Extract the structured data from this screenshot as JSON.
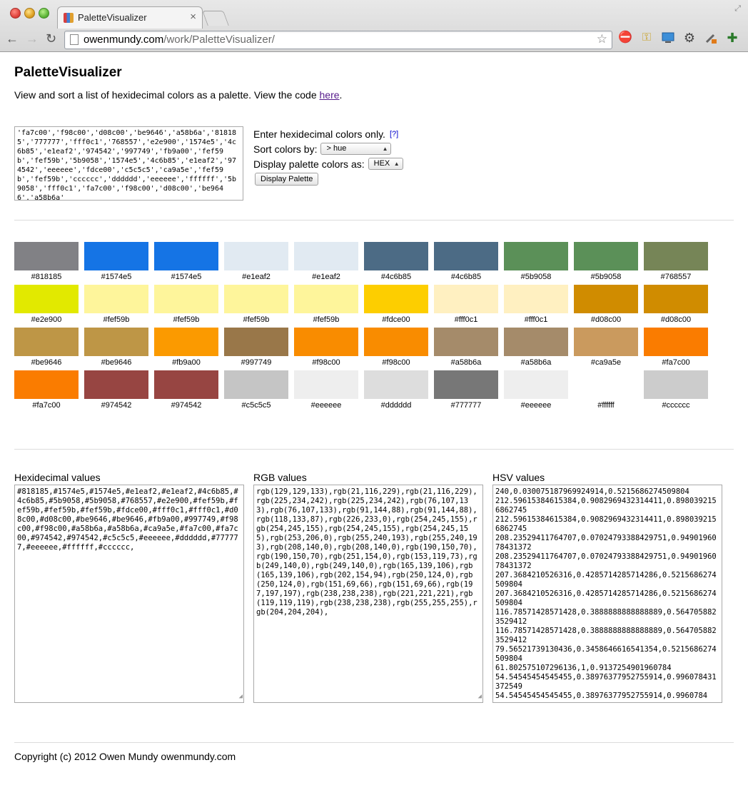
{
  "browser": {
    "tab_title": "PaletteVisualizer",
    "tab_close": "×",
    "url_host": "owenmundy.com",
    "url_path": "/work/PaletteVisualizer/"
  },
  "page": {
    "title": "PaletteVisualizer",
    "intro_text": "View and sort a list of hexidecimal colors as a palette. View the code ",
    "intro_link": "here",
    "intro_end": ".",
    "input_value": "'fa7c00','f98c00','d08c00','be9646','a58b6a','818185','777777','fff0c1','768557','e2e900','1574e5','4c6b85','e1eaf2','974542','997749','fb9a00','fef59b','fef59b','5b9058','1574e5','4c6b85','e1eaf2','974542','eeeeee','fdce00','c5c5c5','ca9a5e','fef59b','fef59b','cccccc','dddddd','eeeeee','ffffff','5b9058','fff0c1','fa7c00','f98c00','d08c00','be9646','a58b6a'",
    "controls": {
      "hex_only_label": "Enter hexidecimal colors only.",
      "help_link": "[?]",
      "sort_label": "Sort colors by:",
      "sort_value": "> hue",
      "display_label": "Display palette colors as:",
      "display_value": "HEX",
      "button_label": "Display Palette"
    },
    "palette": [
      {
        "hex": "#818185"
      },
      {
        "hex": "#1574e5"
      },
      {
        "hex": "#1574e5"
      },
      {
        "hex": "#e1eaf2"
      },
      {
        "hex": "#e1eaf2"
      },
      {
        "hex": "#4c6b85"
      },
      {
        "hex": "#4c6b85"
      },
      {
        "hex": "#5b9058"
      },
      {
        "hex": "#5b9058"
      },
      {
        "hex": "#768557"
      },
      {
        "hex": "#e2e900"
      },
      {
        "hex": "#fef59b"
      },
      {
        "hex": "#fef59b"
      },
      {
        "hex": "#fef59b"
      },
      {
        "hex": "#fef59b"
      },
      {
        "hex": "#fdce00"
      },
      {
        "hex": "#fff0c1"
      },
      {
        "hex": "#fff0c1"
      },
      {
        "hex": "#d08c00"
      },
      {
        "hex": "#d08c00"
      },
      {
        "hex": "#be9646"
      },
      {
        "hex": "#be9646"
      },
      {
        "hex": "#fb9a00"
      },
      {
        "hex": "#997749"
      },
      {
        "hex": "#f98c00"
      },
      {
        "hex": "#f98c00"
      },
      {
        "hex": "#a58b6a"
      },
      {
        "hex": "#a58b6a"
      },
      {
        "hex": "#ca9a5e"
      },
      {
        "hex": "#fa7c00"
      },
      {
        "hex": "#fa7c00"
      },
      {
        "hex": "#974542"
      },
      {
        "hex": "#974542"
      },
      {
        "hex": "#c5c5c5"
      },
      {
        "hex": "#eeeeee"
      },
      {
        "hex": "#dddddd"
      },
      {
        "hex": "#777777"
      },
      {
        "hex": "#eeeeee"
      },
      {
        "hex": "#ffffff"
      },
      {
        "hex": "#cccccc"
      }
    ],
    "hex_title": "Hexidecimal values",
    "hex_values": "#818185,#1574e5,#1574e5,#e1eaf2,#e1eaf2,#4c6b85,#4c6b85,#5b9058,#5b9058,#768557,#e2e900,#fef59b,#fef59b,#fef59b,#fef59b,#fdce00,#fff0c1,#fff0c1,#d08c00,#d08c00,#be9646,#be9646,#fb9a00,#997749,#f98c00,#f98c00,#a58b6a,#a58b6a,#ca9a5e,#fa7c00,#fa7c00,#974542,#974542,#c5c5c5,#eeeeee,#dddddd,#777777,#eeeeee,#ffffff,#cccccc,",
    "rgb_title": "RGB values",
    "rgb_values": "rgb(129,129,133),rgb(21,116,229),rgb(21,116,229),rgb(225,234,242),rgb(225,234,242),rgb(76,107,133),rgb(76,107,133),rgb(91,144,88),rgb(91,144,88),rgb(118,133,87),rgb(226,233,0),rgb(254,245,155),rgb(254,245,155),rgb(254,245,155),rgb(254,245,155),rgb(253,206,0),rgb(255,240,193),rgb(255,240,193),rgb(208,140,0),rgb(208,140,0),rgb(190,150,70),rgb(190,150,70),rgb(251,154,0),rgb(153,119,73),rgb(249,140,0),rgb(249,140,0),rgb(165,139,106),rgb(165,139,106),rgb(202,154,94),rgb(250,124,0),rgb(250,124,0),rgb(151,69,66),rgb(151,69,66),rgb(197,197,197),rgb(238,238,238),rgb(221,221,221),rgb(119,119,119),rgb(238,238,238),rgb(255,255,255),rgb(204,204,204),",
    "hsv_title": "HSV values",
    "hsv_values": "240,0.030075187969924914,0.5215686274509804\n212.59615384615384,0.9082969432314411,0.8980392156862745\n212.59615384615384,0.9082969432314411,0.8980392156862745\n208.23529411764707,0.07024793388429751,0.9490196078431372\n208.23529411764707,0.07024793388429751,0.9490196078431372\n207.3684210526316,0.4285714285714286,0.5215686274509804\n207.3684210526316,0.4285714285714286,0.5215686274509804\n116.78571428571428,0.3888888888888889,0.5647058823529412\n116.78571428571428,0.3888888888888889,0.5647058823529412\n79.56521739130436,0.3458646616541354,0.5215686274509804\n61.802575107296136,1,0.9137254901960784\n54.54545454545455,0.38976377952755914,0.996078431372549\n54.54545454545455,0.38976377952755914,0.9960784",
    "copyright": "Copyright (c) 2012 Owen Mundy owenmundy.com"
  }
}
